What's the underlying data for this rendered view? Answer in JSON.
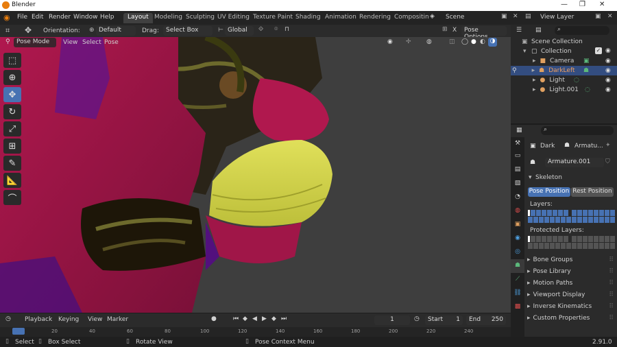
{
  "app": {
    "title": "Blender",
    "version": "2.91.0"
  },
  "window_controls": [
    "—",
    "❐",
    "✕"
  ],
  "menu": [
    "File",
    "Edit",
    "Render",
    "Window",
    "Help"
  ],
  "workspaces": [
    "Layout",
    "Modeling",
    "Sculpting",
    "UV Editing",
    "Texture Paint",
    "Shading",
    "Animation",
    "Rendering",
    "Compositin"
  ],
  "scene": {
    "name": "Scene",
    "view_layer": "View Layer"
  },
  "header": {
    "orientation_label": "Orientation:",
    "orientation_value": "Default",
    "drag_label": "Drag:",
    "drag_value": "Select Box",
    "transform_value": "Global",
    "pose_options": "Pose Options",
    "x_label": "X"
  },
  "viewport_header": {
    "mode": "Pose Mode",
    "menus": [
      "View",
      "Select",
      "Pose"
    ]
  },
  "outliner": {
    "scene_collection": "Scene Collection",
    "collection": "Collection",
    "items": [
      {
        "name": "Camera",
        "selected": false
      },
      {
        "name": "DarkLeft",
        "selected": true
      },
      {
        "name": "Light",
        "selected": false
      },
      {
        "name": "Light.001",
        "selected": false
      }
    ]
  },
  "properties": {
    "object_name": "Dark",
    "armature_name": "Armatu...",
    "data_name": "Armature.001",
    "skeleton": {
      "title": "Skeleton",
      "pose_position": "Pose Position",
      "rest_position": "Rest Position",
      "layers_label": "Layers:",
      "protected_label": "Protected Layers:"
    },
    "panels": [
      "Bone Groups",
      "Pose Library",
      "Motion Paths",
      "Viewport Display",
      "Inverse Kinematics",
      "Custom Properties"
    ]
  },
  "timeline": {
    "menus": [
      "Playback",
      "Keying",
      "View",
      "Marker"
    ],
    "current_frame": "1",
    "start_label": "Start",
    "start": "1",
    "end_label": "End",
    "end": "250",
    "ruler_ticks": [
      "20",
      "40",
      "60",
      "80",
      "100",
      "120",
      "140",
      "160",
      "180",
      "200",
      "220",
      "240"
    ]
  },
  "status": {
    "select": "Select",
    "box_select": "Box Select",
    "rotate": "Rotate View",
    "context": "Pose Context Menu"
  }
}
